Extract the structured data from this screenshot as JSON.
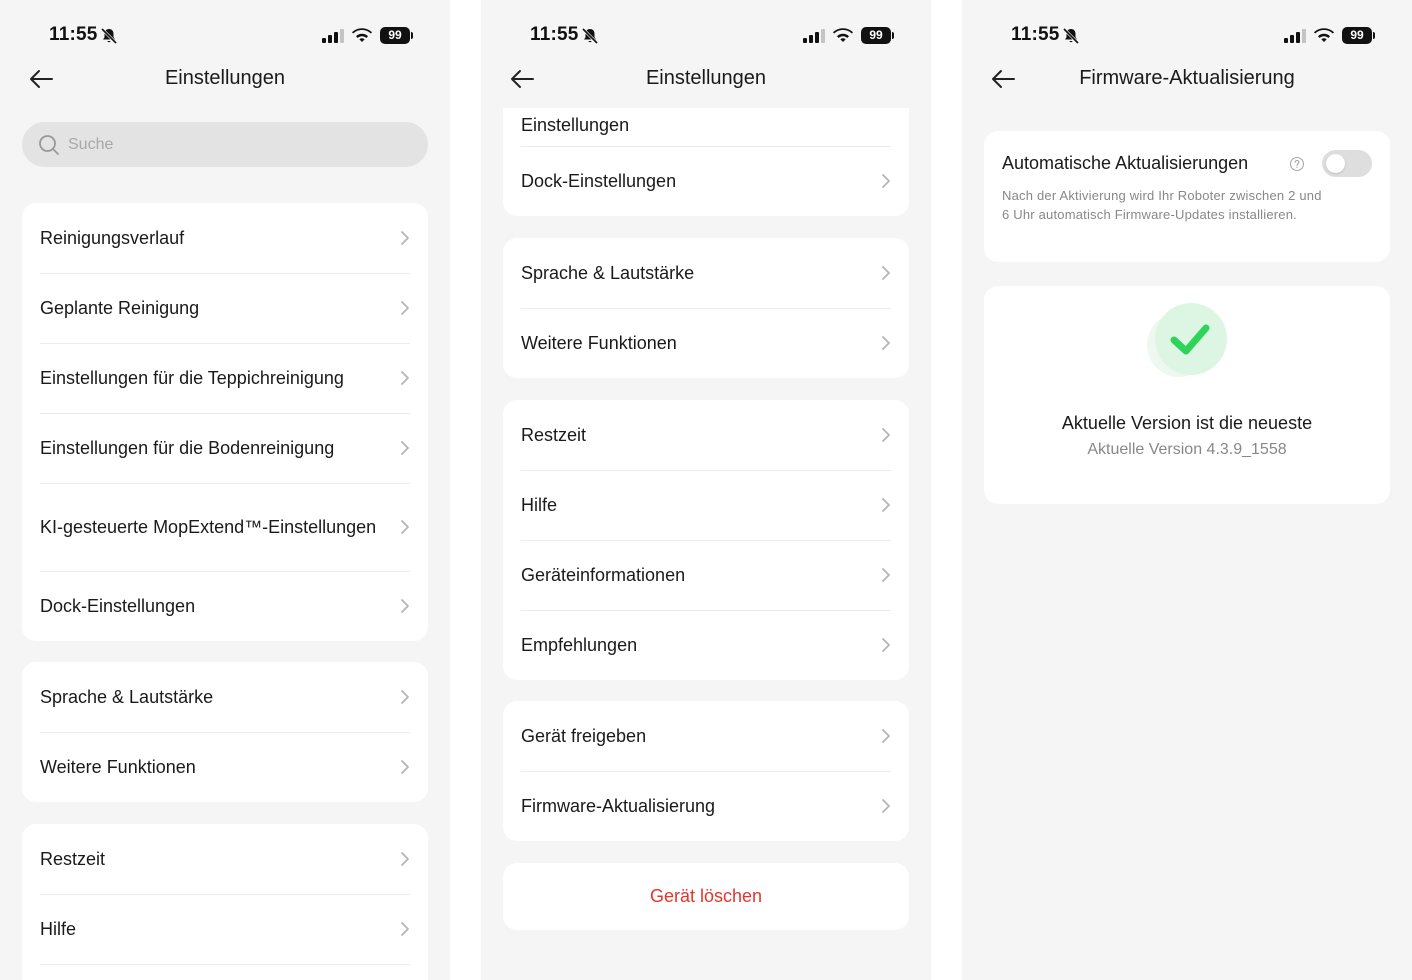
{
  "status_bar": {
    "time": "11:55",
    "battery": "99"
  },
  "screen1": {
    "title": "Einstellungen",
    "search_placeholder": "Suche",
    "groups": [
      [
        "Reinigungsverlauf",
        "Geplante Reinigung",
        "Einstellungen für die Teppichreinigung",
        "Einstellungen für die Bodenreinigung",
        "KI-gesteuerte MopExtend™-Einstellungen",
        "Dock-Einstellungen"
      ],
      [
        "Sprache & Lautstärke",
        "Weitere Funktionen"
      ],
      [
        "Restzeit",
        "Hilfe"
      ]
    ]
  },
  "screen2": {
    "title": "Einstellungen",
    "groups": [
      [
        "Einstellungen",
        "Dock-Einstellungen"
      ],
      [
        "Sprache & Lautstärke",
        "Weitere Funktionen"
      ],
      [
        "Restzeit",
        "Hilfe",
        "Geräteinformationen",
        "Empfehlungen"
      ],
      [
        "Gerät freigeben",
        "Firmware-Aktualisierung"
      ]
    ],
    "delete_label": "Gerät löschen"
  },
  "screen3": {
    "title": "Firmware-Aktualisierung",
    "auto_update": {
      "title": "Automatische Aktualisierungen",
      "description": "Nach der Aktivierung wird Ihr Roboter zwischen 2 und 6 Uhr automatisch Firmware-Updates installieren.",
      "enabled": false
    },
    "status_title": "Aktuelle Version ist die neueste",
    "status_version": "Aktuelle Version 4.3.9_1558"
  },
  "colors": {
    "accent_danger": "#e8332b",
    "check_green": "#2fd35a",
    "background": "#f5f5f5"
  }
}
